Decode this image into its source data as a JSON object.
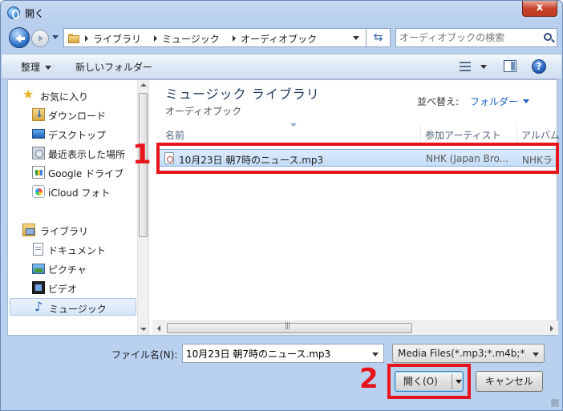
{
  "window": {
    "title": "開く",
    "close_label": "x"
  },
  "nav": {
    "breadcrumbs": [
      "ライブラリ",
      "ミュージック",
      "オーディオブック"
    ],
    "refresh_icon": "refresh-icon",
    "search_placeholder": "オーディオブックの検索"
  },
  "toolbar": {
    "organize_label": "整理",
    "new_folder_label": "新しいフォルダー",
    "help_label": "?"
  },
  "sidebar": {
    "favorites": [
      {
        "label": "お気に入り",
        "icon": "star-icon"
      },
      {
        "label": "ダウンロード",
        "icon": "downloads-folder-icon"
      },
      {
        "label": "デスクトップ",
        "icon": "desktop-icon"
      },
      {
        "label": "最近表示した場所",
        "icon": "recent-places-icon"
      },
      {
        "label": "Google ドライブ",
        "icon": "google-drive-icon"
      },
      {
        "label": "iCloud フォト",
        "icon": "icloud-photos-icon"
      }
    ],
    "libraries": [
      {
        "label": "ライブラリ",
        "icon": "library-icon"
      },
      {
        "label": "ドキュメント",
        "icon": "documents-icon"
      },
      {
        "label": "ピクチャ",
        "icon": "pictures-icon"
      },
      {
        "label": "ビデオ",
        "icon": "videos-icon"
      },
      {
        "label": "ミュージック",
        "icon": "music-icon",
        "selected": true
      }
    ]
  },
  "main": {
    "library_title": "ミュージック ライブラリ",
    "library_subtitle": "オーディオブック",
    "arrange_label": "並べ替え:",
    "arrange_value": "フォルダー",
    "columns": [
      "名前",
      "参加アーティスト",
      "アルバム"
    ],
    "files": [
      {
        "name": "10月23日 朝7時のニュース.mp3",
        "artist": "NHK (Japan Bro...",
        "album": "NHKラ"
      }
    ]
  },
  "footer": {
    "filename_label": "ファイル名(N):",
    "filename_value": "10月23日 朝7時のニュース.mp3",
    "filter_value": "Media Files(*.mp3;*.m4b;*.",
    "open_label": "開く(O)",
    "cancel_label": "キャンセル"
  },
  "annotations": {
    "step1": "1",
    "step2": "2",
    "color": "#e8141b"
  }
}
